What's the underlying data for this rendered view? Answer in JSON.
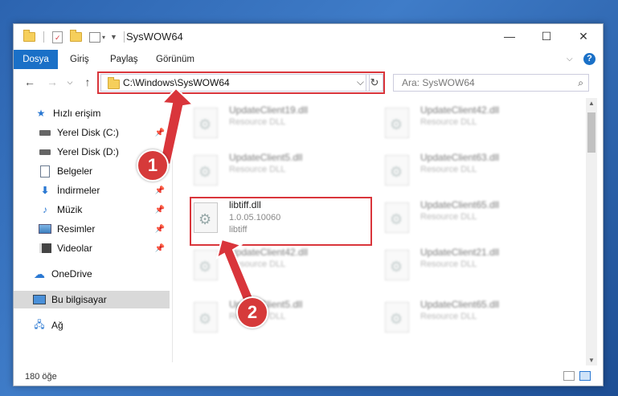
{
  "window": {
    "title": "SysWOW64",
    "controls": {
      "minimize": "—",
      "maximize": "☐",
      "close": "✕"
    }
  },
  "ribbon": {
    "tabs": [
      "Dosya",
      "Giriş",
      "Paylaş",
      "Görünüm"
    ],
    "expand_icon": "chevron-down-icon",
    "help": "?"
  },
  "address": {
    "path": "C:\\Windows\\SysWOW64",
    "dropdown": "⌵",
    "refresh": "↻"
  },
  "search": {
    "placeholder": "Ara: SysWOW64"
  },
  "nav": {
    "items": [
      {
        "label": "Hızlı erişim",
        "icon": "star-icon"
      },
      {
        "label": "Yerel Disk (C:)",
        "icon": "drive-icon"
      },
      {
        "label": "Yerel Disk (D:)",
        "icon": "drive-icon"
      },
      {
        "label": "Belgeler",
        "icon": "document-icon"
      },
      {
        "label": "İndirmeler",
        "icon": "download-icon"
      },
      {
        "label": "Müzik",
        "icon": "music-icon"
      },
      {
        "label": "Resimler",
        "icon": "pictures-icon"
      },
      {
        "label": "Videolar",
        "icon": "video-icon"
      },
      {
        "label": "OneDrive",
        "icon": "cloud-icon"
      },
      {
        "label": "Bu bilgisayar",
        "icon": "computer-icon"
      },
      {
        "label": "Ağ",
        "icon": "network-icon"
      }
    ]
  },
  "files": {
    "left": [
      {
        "name": "UpdateClient19.dll",
        "type": "Resource DLL"
      },
      {
        "name": "UpdateClient5.dll",
        "type": "Resource DLL"
      },
      {
        "name": "libtiff.dll",
        "version": "1.0.05.10060",
        "desc": "libtiff"
      },
      {
        "name": "UpdateClient42.dll",
        "type": "Resource DLL"
      },
      {
        "name": "UpdateClient5.dll",
        "type": "Resource DLL"
      }
    ],
    "right": [
      {
        "name": "UpdateClient42.dll",
        "type": "Resource DLL"
      },
      {
        "name": "UpdateClient63.dll",
        "type": "Resource DLL"
      },
      {
        "name": "UpdateClient65.dll",
        "type": "Resource DLL"
      },
      {
        "name": "UpdateClient21.dll",
        "type": "Resource DLL"
      },
      {
        "name": "UpdateClient65.dll",
        "type": "Resource DLL"
      }
    ]
  },
  "status": {
    "count": "180 öğe"
  },
  "annotations": {
    "badge1": "1",
    "badge2": "2"
  },
  "colors": {
    "accent": "#1a70c7",
    "highlight": "#d9353b"
  }
}
